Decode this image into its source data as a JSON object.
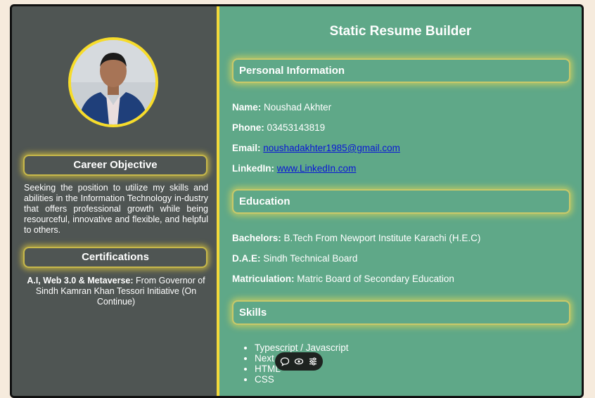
{
  "page_title": "Static Resume Builder",
  "sidebar": {
    "career_objective_heading": "Career Objective",
    "career_objective_text": "Seeking the position to utilize my skills and abilities in the Information Technology in-dustry that offers professional growth while being resourceful, innovative and flexible, and helpful to others.",
    "certifications_heading": "Certifications",
    "certification_title": "A.I, Web 3.0 & Metaverse:",
    "certification_text": " From Governor of Sindh Kamran Khan Tessori Initiative (On Continue)"
  },
  "personal": {
    "heading": "Personal Information",
    "name_label": "Name:",
    "name": " Noushad Akhter",
    "phone_label": "Phone:",
    "phone": " 03453143819",
    "email_label": "Email:",
    "email": "noushadakhter1985@gmail.com",
    "linkedin_label": "LinkedIn:",
    "linkedin": "www.LinkedIn.com"
  },
  "education": {
    "heading": "Education",
    "items": [
      {
        "label": "Bachelors:",
        "value": " B.Tech From Newport Institute Karachi (H.E.C)"
      },
      {
        "label": "D.A.E:",
        "value": " Sindh Technical Board"
      },
      {
        "label": "Matriculation:",
        "value": " Matric Board of Secondary Education"
      }
    ]
  },
  "skills": {
    "heading": "Skills",
    "items": [
      "Typescript / Javascript",
      "Next",
      "HTML",
      "CSS"
    ]
  },
  "colors": {
    "sidebar_bg": "#4f5553",
    "main_bg": "#5fa888",
    "accent": "#f2d93a",
    "link": "#0a16d6"
  },
  "toolbar": {
    "icons": [
      "comment-icon",
      "eye-icon",
      "settings-icon"
    ]
  }
}
